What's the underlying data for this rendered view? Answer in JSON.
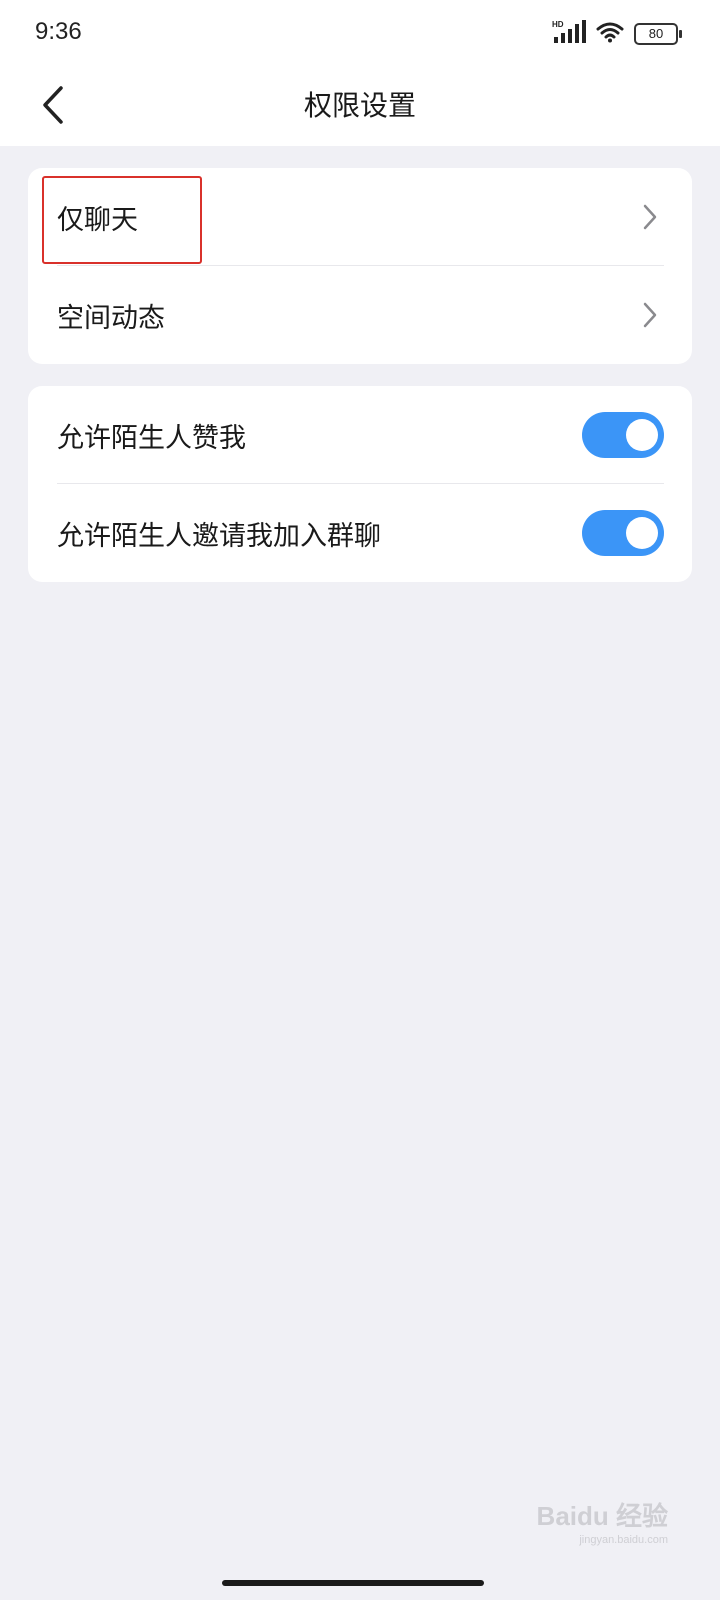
{
  "status_bar": {
    "time": "9:36",
    "network": "HD",
    "battery": "80",
    "icons": [
      "signal-icon",
      "wifi-icon",
      "battery-icon"
    ]
  },
  "header": {
    "title": "权限设置",
    "back_icon": "chevron-left-icon"
  },
  "groups": [
    {
      "items": [
        {
          "label": "仅聊天",
          "icon": "chevron-right-icon"
        },
        {
          "label": "空间动态",
          "icon": "chevron-right-icon"
        }
      ]
    },
    {
      "items": [
        {
          "label": "允许陌生人赞我",
          "toggle_on": true
        },
        {
          "label": "允许陌生人邀请我加入群聊",
          "toggle_on": true
        }
      ]
    }
  ],
  "watermark": {
    "text": "Baidu 经验",
    "sub": "jingyan.baidu.com"
  },
  "colors": {
    "background": "#f0f0f5",
    "toggle_on": "#3b95f7",
    "highlight": "#d9312b"
  }
}
